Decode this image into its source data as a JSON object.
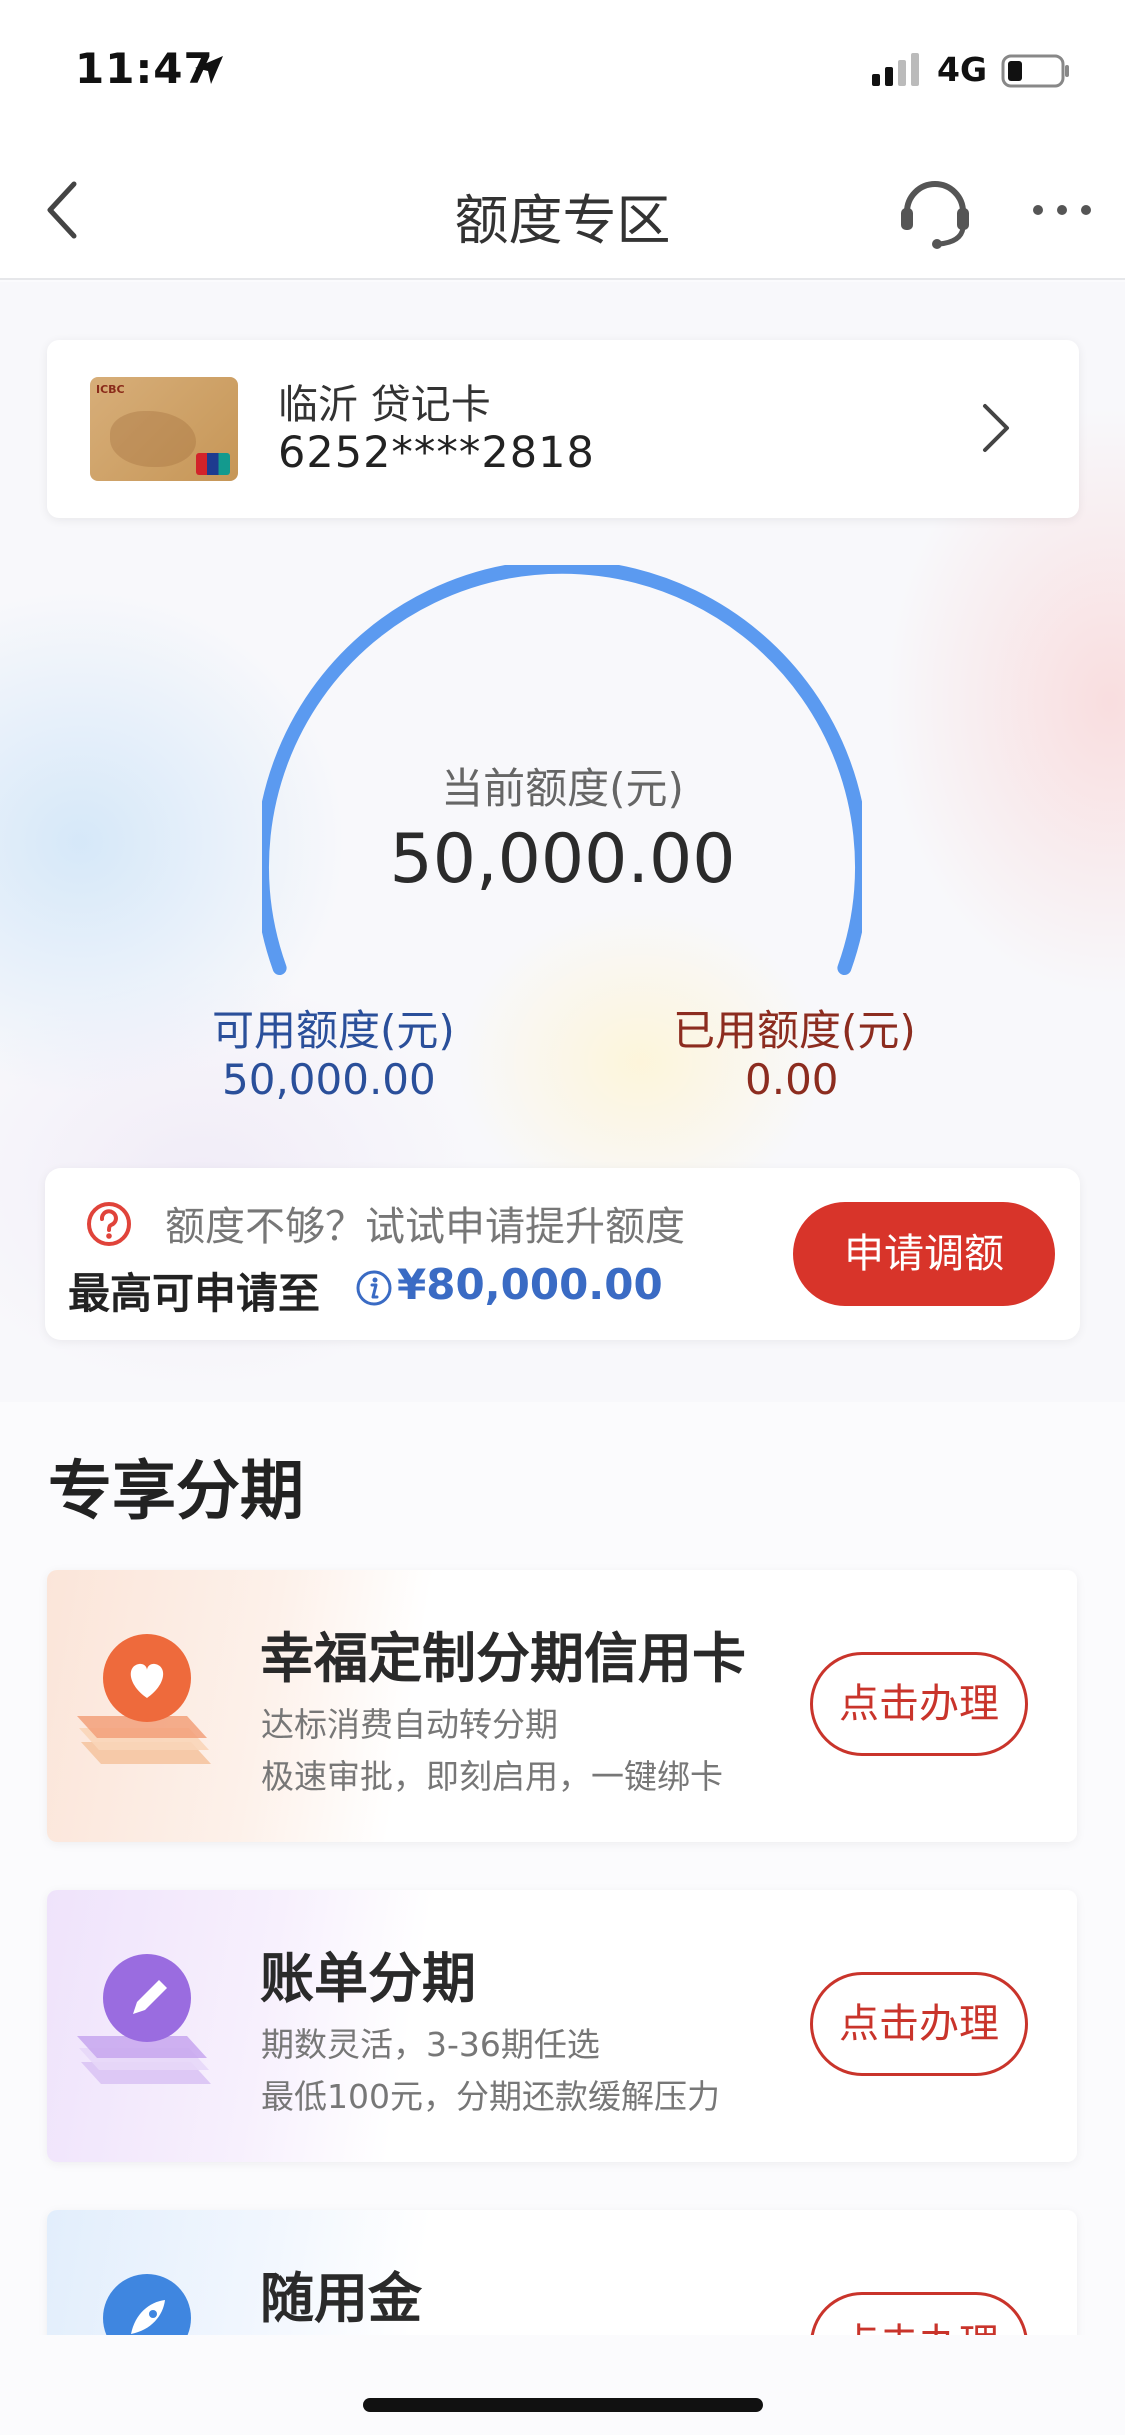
{
  "status_bar": {
    "time": "11:47",
    "network": "4G"
  },
  "nav": {
    "title": "额度专区"
  },
  "card": {
    "name": "临沂 贷记卡",
    "number": "6252****2818"
  },
  "gauge": {
    "label": "当前额度(元)",
    "value": "50,000.00",
    "fill_fraction": 1.0,
    "color": "#5b9af0"
  },
  "available": {
    "label": "可用额度(元)",
    "value": "50,000.00"
  },
  "used": {
    "label": "已用额度(元)",
    "value": "0.00"
  },
  "raise": {
    "hint": "额度不够？试试申请提升额度",
    "max_label": "最高可申请至",
    "max_value": "¥80,000.00",
    "button_label": "申请调额"
  },
  "section": {
    "title": "专享分期"
  },
  "promos": [
    {
      "title": "幸福定制分期信用卡",
      "desc1": "达标消费自动转分期",
      "desc2": "极速审批，即刻启用，一键绑卡",
      "button_label": "点击办理",
      "icon": "heart-icon"
    },
    {
      "title": "账单分期",
      "desc1": "期数灵活，3-36期任选",
      "desc2": "最低100元，分期还款缓解压力",
      "button_label": "点击办理",
      "icon": "pencil-icon"
    },
    {
      "title": "随用金",
      "desc1": "",
      "desc2": "",
      "button_label": "点击办理",
      "icon": "rocket-icon"
    }
  ],
  "colors": {
    "accent_red": "#d8342a",
    "link_blue": "#3a6bc4",
    "available_blue": "#2a4f9a",
    "used_brown": "#8c2c1f"
  }
}
